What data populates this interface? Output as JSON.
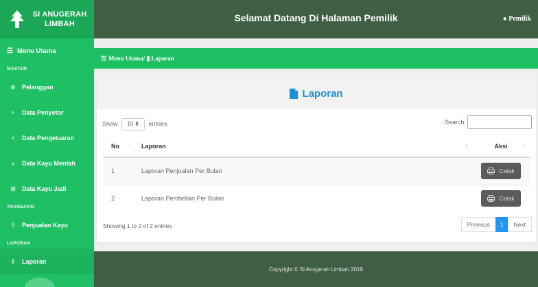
{
  "sidebar": {
    "brand": "SI ANUGERAH LIMBAH",
    "menu_main": "Menu Utama",
    "sections": {
      "master": "MASTER",
      "transaksi": "TRANSAKSI",
      "laporan": "LAPORAN"
    },
    "items": [
      {
        "label": "Pelanggan",
        "icon": "users-icon"
      },
      {
        "label": "Data Penyetor",
        "icon": "user-icon"
      },
      {
        "label": "Data Pengeluaran",
        "icon": "user-icon"
      },
      {
        "label": "Data Kayu Mentah",
        "icon": "tree-icon"
      },
      {
        "label": "Data Kayu Jadi",
        "icon": "box-icon"
      },
      {
        "label": "Penjualan Kayu",
        "icon": "dollar-icon"
      },
      {
        "label": "Laporan",
        "icon": "file-icon"
      }
    ]
  },
  "header": {
    "title": "Selamat Datang Di Halaman Pemilik",
    "user": "Pemilik"
  },
  "breadcrumb": {
    "root": "Menu Utama",
    "current": "Laporan"
  },
  "card": {
    "title": "Laporan"
  },
  "controls": {
    "show": "Show",
    "page_size": "10",
    "entries": "entries",
    "search_label": "Search:"
  },
  "table": {
    "headers": {
      "no": "No",
      "laporan": "Laporan",
      "aksi": "Aksi"
    },
    "rows": [
      {
        "no": "1",
        "laporan": "Laporan Penjualan Per Bulan",
        "action": "Cetak"
      },
      {
        "no": "2",
        "laporan": "Laporan Pembelian Per Bulan",
        "action": "Cetak"
      }
    ]
  },
  "info": "Showing 1 to 2 of 2 entries",
  "pager": {
    "prev": "Previous",
    "page": "1",
    "next": "Next"
  },
  "footer": "Copyright © Si Anugerah Limbah 2019",
  "colors": {
    "sidebar": "#1fbf63",
    "header": "#3f5f44",
    "accent_blue": "#1d8fd6",
    "page_active": "#2196f3"
  }
}
